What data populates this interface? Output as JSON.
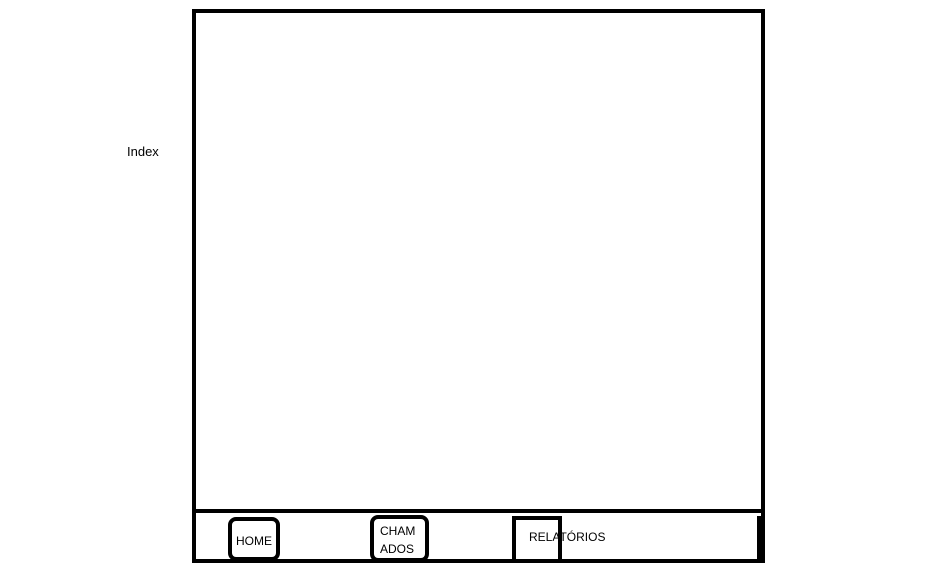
{
  "page": {
    "label": "Index"
  },
  "nav": {
    "home_label": "HOME",
    "chamados_label": "CHAM\nADOS",
    "relatorios_label": "RELATÓRIOS"
  }
}
